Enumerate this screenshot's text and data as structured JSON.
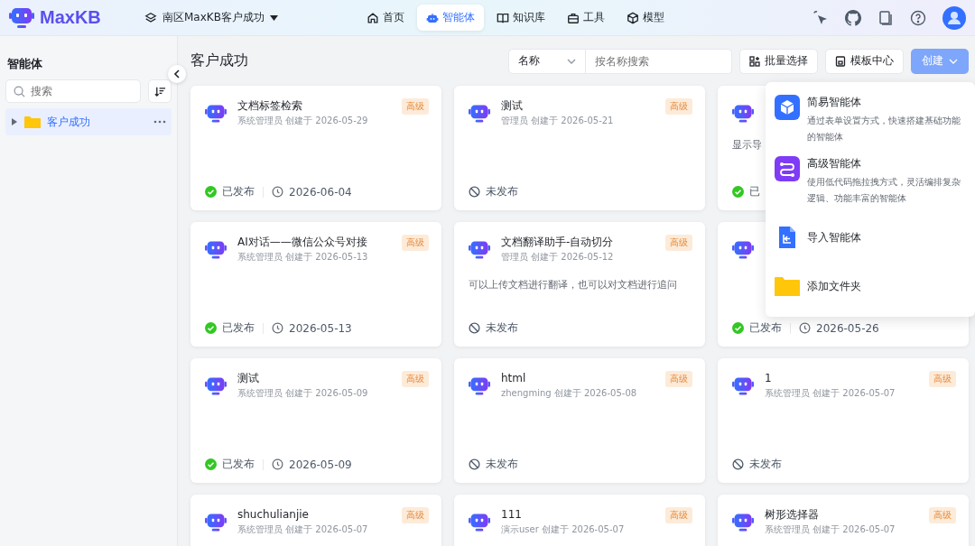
{
  "header": {
    "logo": "MaxKB",
    "workspace": "南区MaxKB客户成功",
    "nav": [
      {
        "label": "首页",
        "selected": false
      },
      {
        "label": "智能体",
        "selected": true
      },
      {
        "label": "知识库",
        "selected": false
      },
      {
        "label": "工具",
        "selected": false
      },
      {
        "label": "模型",
        "selected": false
      }
    ]
  },
  "sidebar": {
    "title": "智能体",
    "search": {
      "placeholder": "搜索"
    },
    "tree": [
      {
        "label": "客户成功",
        "selected": true,
        "expanded": false
      }
    ]
  },
  "main": {
    "title": "客户成功",
    "filter": "名称",
    "search": {
      "placeholder": "按名称搜索"
    },
    "buttons": [
      "批量选择",
      "模板中心"
    ],
    "create": "创建",
    "cards": [
      {
        "title": "文档标签检索",
        "meta": "系统管理员 创建于 2026-05-29",
        "badge": "高级",
        "published": true,
        "status": "已发布",
        "date": "2026-06-04"
      },
      {
        "title": "测试",
        "meta": "管理员 创建于 2026-05-21",
        "badge": "高级",
        "published": false,
        "status": "未发布"
      },
      {
        "description": "显示导",
        "published": true,
        "status": "已"
      },
      {
        "title": "AI对话——微信公众号对接",
        "meta": "系统管理员 创建于 2026-05-13",
        "badge": "高级",
        "published": true,
        "status": "已发布",
        "date": "2026-05-13"
      },
      {
        "title": "文档翻译助手-自动切分",
        "meta": "管理员 创建于 2026-05-12",
        "badge": "高级",
        "description": "可以上传文档进行翻译，也可以对文档进行追问",
        "published": false,
        "status": "未发布"
      },
      {
        "published": true,
        "status": "已发布",
        "date": "2026-05-26"
      },
      {
        "title": "测试",
        "meta": "系统管理员 创建于 2026-05-09",
        "badge": "高级",
        "published": true,
        "status": "已发布",
        "date": "2026-05-09"
      },
      {
        "title": "html",
        "meta": "zhengming 创建于 2026-05-08",
        "badge": "高级",
        "published": false,
        "status": "未发布"
      },
      {
        "title": "1",
        "meta": "系统管理员 创建于 2026-05-07",
        "badge": "高级",
        "published": false,
        "status": "未发布"
      },
      {
        "title": "shuchulianjie",
        "meta": "系统管理员 创建于 2026-05-07",
        "badge": "高级"
      },
      {
        "title": "111",
        "meta": "演示user 创建于 2026-05-07",
        "badge": "高级"
      },
      {
        "title": "树形选择器",
        "meta": "系统管理员 创建于 2026-05-07",
        "badge": "高级"
      }
    ],
    "create_menu": [
      {
        "title": "简易智能体",
        "description": "通过表单设置方式，快速搭建基础功能的智能体"
      },
      {
        "title": "高级智能体",
        "description": "使用低代码拖拉拽方式，灵活编排复杂逻辑、功能丰富的智能体"
      },
      {
        "title": "导入智能体"
      },
      {
        "title": "添加文件夹"
      }
    ]
  }
}
